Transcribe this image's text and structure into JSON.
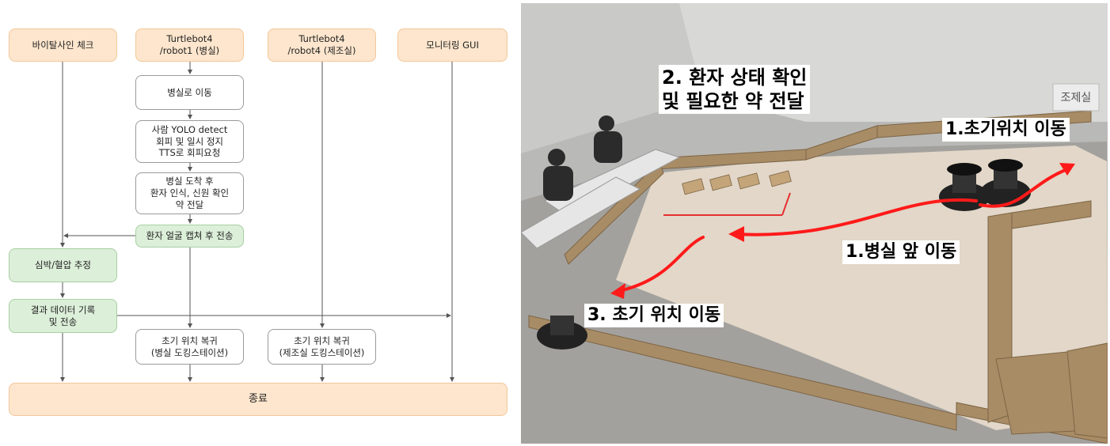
{
  "flowchart": {
    "headers": {
      "vital": "바이탈사인 체크",
      "robot1": "Turtlebot4\n/robot1 (병실)",
      "robot4": "Turtlebot4\n/robot4 (제조실)",
      "gui": "모니터링 GUI"
    },
    "steps": {
      "move_ward": "병실로 이동",
      "detect": "사람 YOLO detect\n회피 및 일시 정지\nTTS로 회피요청",
      "arrive": "병실 도착 후\n환자 인식, 신원 확인\n약 전달",
      "capture": "환자 얼굴 캡쳐 후 전송",
      "estimate": "심박/혈압 추정",
      "record": "결과 데이터 기록\n및 전송",
      "return1": "초기 위치 복귀\n(병실 도킹스테이션)",
      "return4": "초기 위치 복귀\n(제조실 도킹스테이션)",
      "end": "종료"
    },
    "colors": {
      "orange": "#fde6cd",
      "green": "#dcefd9",
      "line": "#555555"
    }
  },
  "photo": {
    "callouts": {
      "c1": "1.초기위치 이동",
      "c2": "2. 환자 상태 확인\n및 필요한 약 전달",
      "c3": "1.병실 앞 이동",
      "c4": "3. 초기 위치 이동"
    },
    "door_sign": "조제실",
    "path_color": "#ff1a1a"
  }
}
